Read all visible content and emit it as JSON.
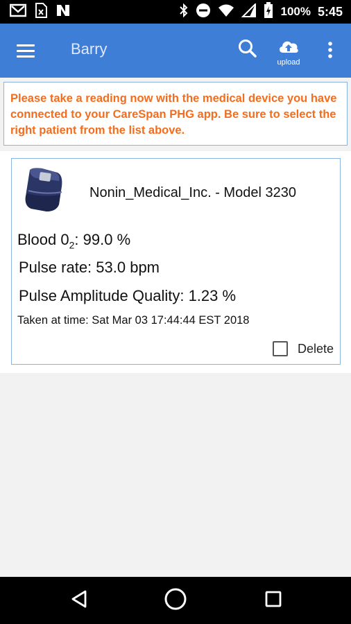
{
  "status_bar": {
    "battery": "100%",
    "time": "5:45"
  },
  "app_bar": {
    "title": "Barry",
    "upload_label": "upload"
  },
  "notice": {
    "text": "Please take a reading now with the medical device you have connected to your CareSpan PHG app. Be sure to select the right patient from the list above."
  },
  "reading_card": {
    "device": "Nonin_Medical_Inc. - Model 3230",
    "blood_o2_label": "Blood 0",
    "blood_o2_sub": "2",
    "blood_o2_value": ": 99.0 %",
    "pulse_rate": "Pulse rate: 53.0 bpm",
    "pulse_amplitude": "Pulse Amplitude Quality: 1.23 %",
    "taken_at": "Taken at time: Sat Mar 03 17:44:44 EST 2018",
    "delete_label": "Delete",
    "delete_checked": false
  },
  "colors": {
    "app_bar": "#3f7ed6",
    "notice_text": "#f26d1d",
    "border": "#8ab3e0"
  },
  "icons": [
    "gmail-icon",
    "sim-card-icon",
    "news-icon",
    "bluetooth-icon",
    "do-not-disturb-icon",
    "wifi-icon",
    "cellular-icon",
    "battery-icon",
    "menu-icon",
    "search-icon",
    "cloud-upload-icon",
    "more-vert-icon",
    "back-icon",
    "home-icon",
    "recents-icon"
  ]
}
